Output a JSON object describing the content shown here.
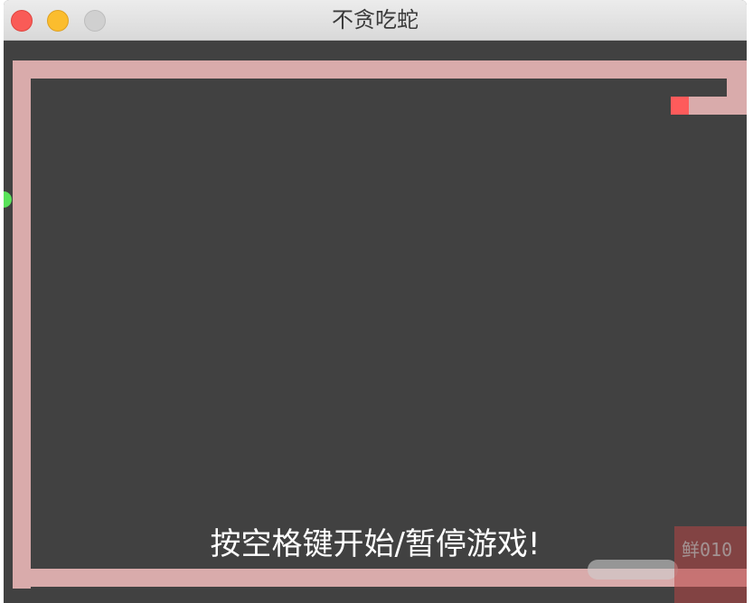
{
  "window": {
    "title": "不贪吃蛇"
  },
  "game": {
    "message": "按空格键开始/暂停游戏!",
    "colors": {
      "background": "#414141",
      "snake_body": "#d9abab",
      "snake_head": "#fe5b5b",
      "food": "#59e35a"
    }
  },
  "watermark": {
    "text": "鲜010"
  }
}
